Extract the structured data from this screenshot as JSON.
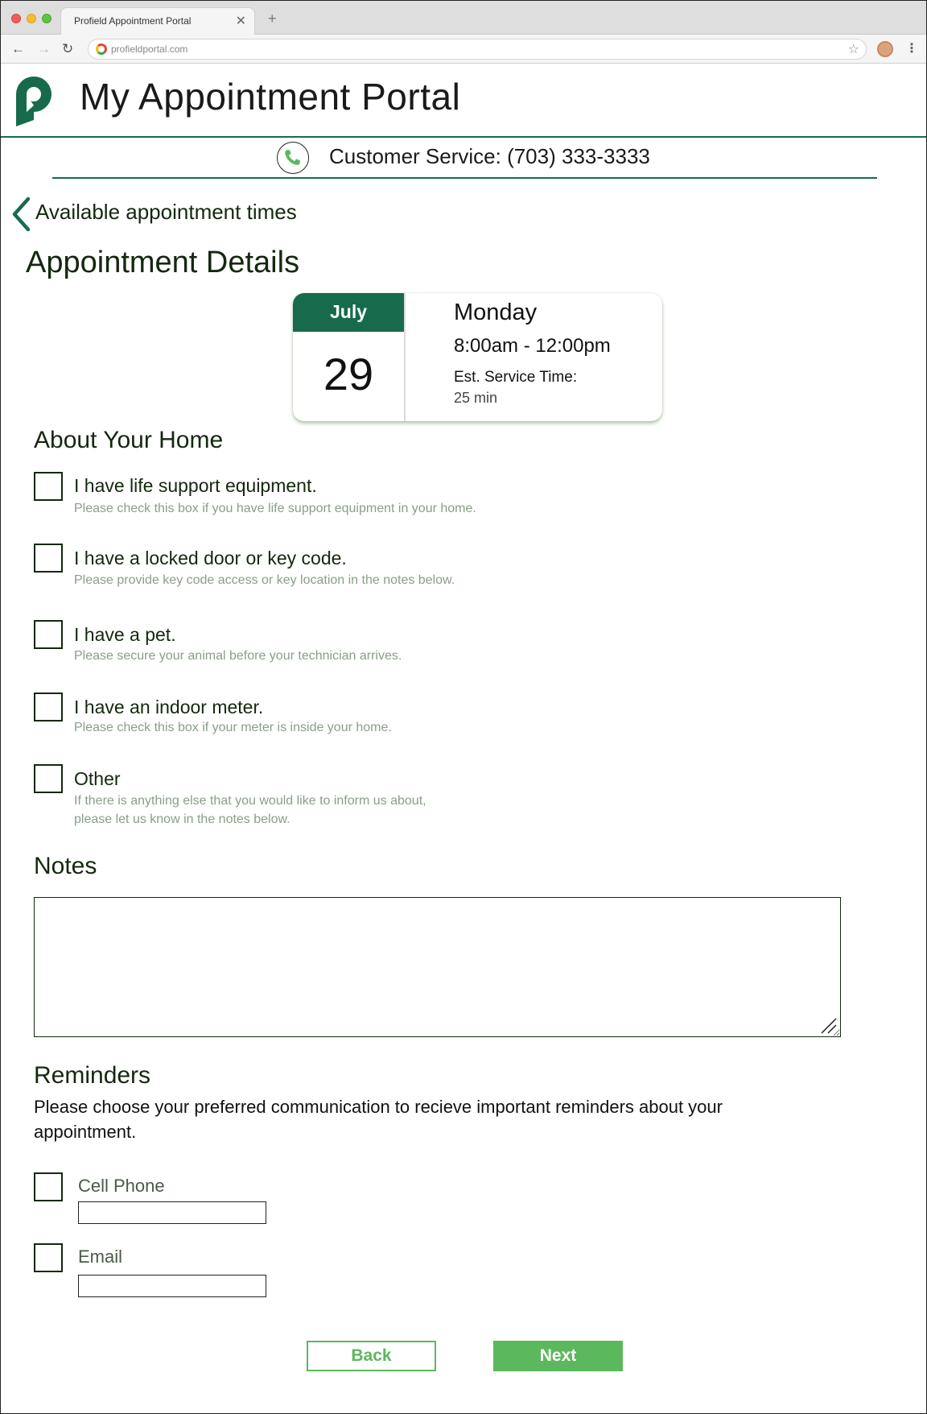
{
  "browser": {
    "tab_title": "Profield Appointment Portal",
    "tab_close": "✕",
    "new_tab": "+",
    "url": "profieldportal.com",
    "nav_back": "←",
    "nav_forward": "→",
    "nav_reload": "↻",
    "bookmark": "☆",
    "menu": "⋮"
  },
  "header": {
    "title": "My Appointment Portal",
    "customer_service": "Customer Service: (703) 333-3333"
  },
  "back_link": {
    "label": "Available appointment times"
  },
  "page_title": "Appointment Details",
  "appointment": {
    "month": "July",
    "day": "29",
    "weekday": "Monday",
    "time_range": "8:00am - 12:00pm",
    "est_label": "Est. Service Time:",
    "est_value": "25 min"
  },
  "about_home": {
    "heading": "About Your Home",
    "options": [
      {
        "label": "I have life support equipment.",
        "help": "Please check this box if you have life support equipment in your home.",
        "checked": false
      },
      {
        "label": "I have a locked door or key code.",
        "help": "Please provide key code access or key location in the notes below.",
        "checked": false
      },
      {
        "label": "I have a pet.",
        "help": "Please secure your animal before your technician arrives.",
        "checked": false
      },
      {
        "label": "I have an indoor meter.",
        "help": "Please check this box if your meter is inside your home.",
        "checked": false
      },
      {
        "label": "Other",
        "help_line1": "If there is anything else that you would like to inform us about,",
        "help_line2": "please let us know in the notes below.",
        "checked": false
      }
    ]
  },
  "notes": {
    "heading": "Notes",
    "value": ""
  },
  "reminders": {
    "heading": "Reminders",
    "description": "Please choose your preferred communication to recieve important reminders about your appointment.",
    "cell_label": "Cell Phone",
    "cell_value": "",
    "email_label": "Email",
    "email_value": ""
  },
  "buttons": {
    "back": "Back",
    "next": "Next"
  },
  "colors": {
    "primary_green": "#176b4c",
    "button_green": "#5cb85c",
    "text_dark": "#14280f",
    "help_text": "#8a9e88"
  },
  "icons": {
    "logo": "profield-p-logo",
    "phone": "phone-icon",
    "back": "chevron-left-icon"
  }
}
